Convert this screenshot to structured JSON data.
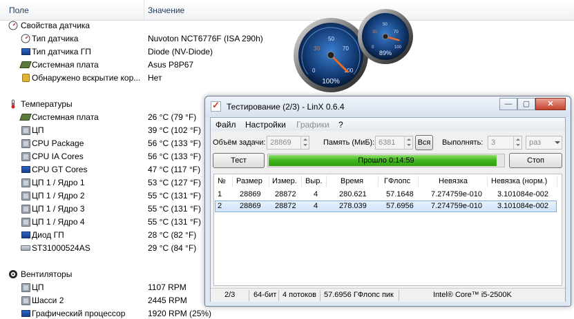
{
  "columns": {
    "field": "Поле",
    "value": "Значение"
  },
  "sensor_sections": [
    {
      "title": "Свойства датчика",
      "items": [
        {
          "name": "Тип датчика",
          "value": "Nuvoton NCT6776F  (ISA 290h)"
        },
        {
          "name": "Тип датчика ГП",
          "value": "Diode  (NV-Diode)"
        },
        {
          "name": "Системная плата",
          "value": "Asus P8P67"
        },
        {
          "name": "Обнаружено вскрытие кор...",
          "value": "Нет"
        }
      ]
    },
    {
      "title": "Температуры",
      "items": [
        {
          "name": "Системная плата",
          "value": "26 °C  (79 °F)"
        },
        {
          "name": "ЦП",
          "value": "39 °C  (102 °F)"
        },
        {
          "name": "CPU Package",
          "value": "56 °C  (133 °F)"
        },
        {
          "name": "CPU IA Cores",
          "value": "56 °C  (133 °F)"
        },
        {
          "name": "CPU GT Cores",
          "value": "47 °C  (117 °F)"
        },
        {
          "name": "ЦП 1 / Ядро 1",
          "value": "53 °C  (127 °F)"
        },
        {
          "name": "ЦП 1 / Ядро 2",
          "value": "55 °C  (131 °F)"
        },
        {
          "name": "ЦП 1 / Ядро 3",
          "value": "55 °C  (131 °F)"
        },
        {
          "name": "ЦП 1 / Ядро 4",
          "value": "55 °C  (131 °F)"
        },
        {
          "name": "Диод ГП",
          "value": "28 °C  (82 °F)"
        },
        {
          "name": "ST31000524AS",
          "value": "29 °C  (84 °F)"
        }
      ]
    },
    {
      "title": "Вентиляторы",
      "items": [
        {
          "name": "ЦП",
          "value": "1107 RPM"
        },
        {
          "name": "Шасси 2",
          "value": "2445 RPM"
        },
        {
          "name": "Графический процессор",
          "value": "1920 RPM  (25%)"
        }
      ]
    }
  ],
  "gauges": [
    {
      "label": "100%",
      "level": 1.0,
      "ticks": [
        "0",
        "30",
        "50",
        "70",
        "100"
      ]
    },
    {
      "label": "89%",
      "level": 0.89,
      "ticks": [
        "0",
        "30",
        "50",
        "70",
        "100"
      ]
    }
  ],
  "linx": {
    "title": "Тестирование (2/3) - LinX 0.6.4",
    "menu": [
      "Файл",
      "Настройки",
      "Графики",
      "?"
    ],
    "task_label": "Объём задачи:",
    "task_value": "28869",
    "memory_label": "Память (МиБ):",
    "memory_value": "6381",
    "all_button": "Вся",
    "run_label": "Выполнять:",
    "run_count": "3",
    "run_unit": "раз",
    "test_button": "Тест",
    "progress_text": "Прошло 0:14:59",
    "progress": 0.97,
    "stop_button": "Стоп",
    "table": {
      "headers": [
        "№",
        "Размер",
        "Измер.",
        "Выр.",
        "Время",
        "ГФлопс",
        "Невязка",
        "Невязка (норм.)"
      ],
      "rows": [
        [
          "1",
          "28869",
          "28872",
          "4",
          "280.621",
          "57.1648",
          "7.274759e-010",
          "3.101084e-002"
        ],
        [
          "2",
          "28869",
          "28872",
          "4",
          "278.039",
          "57.6956",
          "7.274759e-010",
          "3.101084e-002"
        ]
      ]
    },
    "status": [
      "2/3",
      "64-бит",
      "4 потоков",
      "57.6956 ГФлопс пик",
      "Intel® Core™ i5-2500K"
    ]
  },
  "colors": {
    "progress_green": "#3fb51c",
    "selection_blue": "#cfe4fb",
    "gauge_dial": "#1b4d8c",
    "needle": "#e8541e"
  }
}
